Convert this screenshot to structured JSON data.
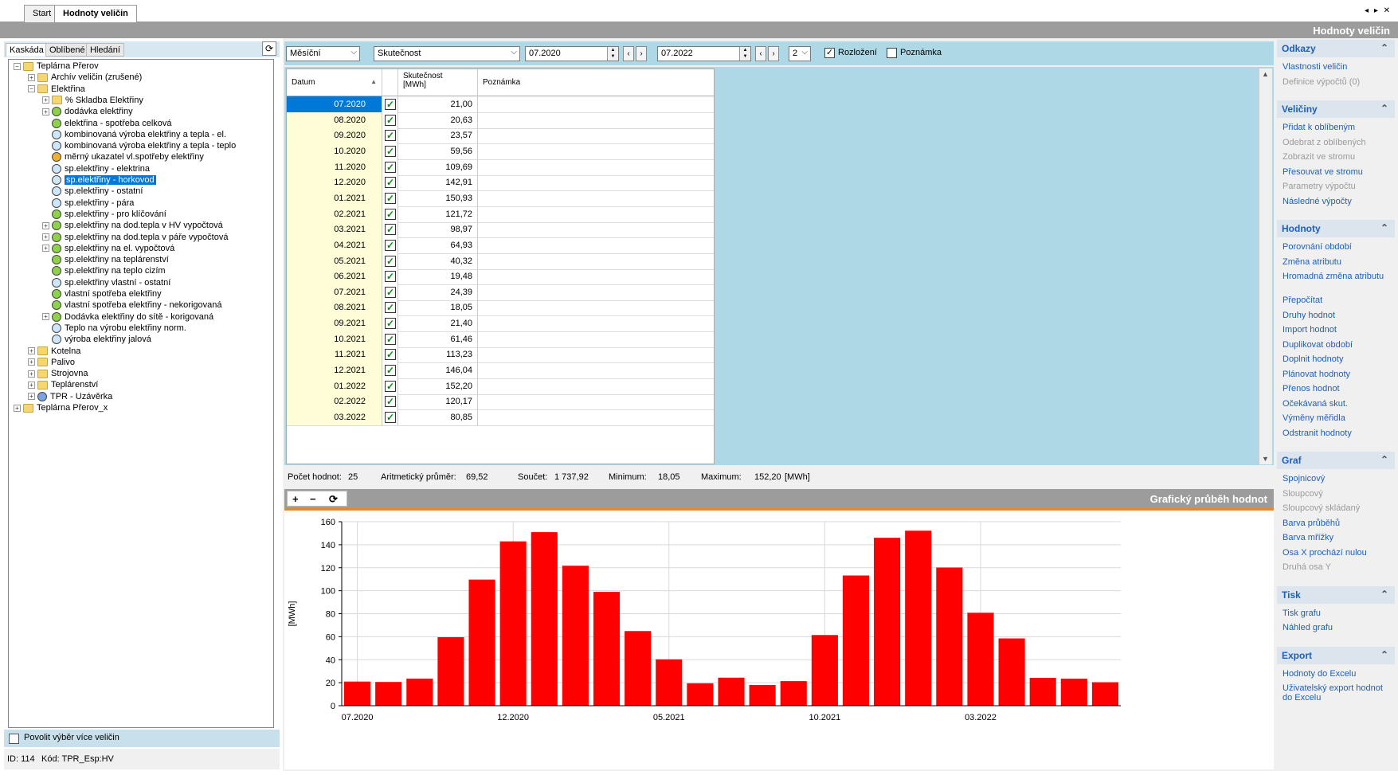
{
  "tabs": {
    "start": "Start",
    "active": "Hodnoty veličin"
  },
  "window_title": "Hodnoty veličin",
  "left": {
    "tabs": [
      "Kaskáda",
      "Oblíbené",
      "Hledání"
    ],
    "tree": [
      {
        "label": "Teplárna Přerov",
        "level": 0,
        "icon": "folder",
        "exp": "-"
      },
      {
        "label": "Archív veličin (zrušené)",
        "level": 1,
        "icon": "folder",
        "exp": "+"
      },
      {
        "label": "Elektřina",
        "level": 1,
        "icon": "folder",
        "exp": "-"
      },
      {
        "label": "% Skladba Elektřiny",
        "level": 2,
        "icon": "folder",
        "exp": "+"
      },
      {
        "label": "dodávka elektřiny",
        "level": 2,
        "icon": "green",
        "exp": "+"
      },
      {
        "label": "elektřina - spotřeba celková",
        "level": 2,
        "icon": "green",
        "exp": ""
      },
      {
        "label": "kombinovaná výroba elektřiny a tepla - el.",
        "level": 2,
        "icon": "blue",
        "exp": ""
      },
      {
        "label": "kombinovaná výroba elektřiny a tepla - teplo",
        "level": 2,
        "icon": "blue",
        "exp": ""
      },
      {
        "label": "měrný ukazatel vl.spotřeby elektřiny",
        "level": 2,
        "icon": "orange",
        "exp": ""
      },
      {
        "label": "sp.elektřiny - elektrina",
        "level": 2,
        "icon": "blue",
        "exp": ""
      },
      {
        "label": "sp.elektřiny - horkovod",
        "level": 2,
        "icon": "blue",
        "exp": "",
        "selected": true
      },
      {
        "label": "sp.elektřiny - ostatní",
        "level": 2,
        "icon": "blue",
        "exp": ""
      },
      {
        "label": "sp.elektřiny - pára",
        "level": 2,
        "icon": "blue",
        "exp": ""
      },
      {
        "label": "sp.elektřiny - pro klíčování",
        "level": 2,
        "icon": "green",
        "exp": ""
      },
      {
        "label": "sp.elektřiny na dod.tepla v HV vypočtová",
        "level": 2,
        "icon": "green",
        "exp": "+"
      },
      {
        "label": "sp.elektřiny na dod.tepla v páře vypočtová",
        "level": 2,
        "icon": "green",
        "exp": "+"
      },
      {
        "label": "sp.elektřiny na el. vypočtová",
        "level": 2,
        "icon": "green",
        "exp": "+"
      },
      {
        "label": "sp.elektřiny na teplárenství",
        "level": 2,
        "icon": "green",
        "exp": ""
      },
      {
        "label": "sp.elektřiny na teplo cizím",
        "level": 2,
        "icon": "green",
        "exp": ""
      },
      {
        "label": "sp.elektřiny vlastní - ostatní",
        "level": 2,
        "icon": "blue",
        "exp": ""
      },
      {
        "label": "vlastní spotřeba elektřiny",
        "level": 2,
        "icon": "green",
        "exp": ""
      },
      {
        "label": "vlastní spotřeba elektřiny - nekorigovaná",
        "level": 2,
        "icon": "green",
        "exp": ""
      },
      {
        "label": "Dodávka elektřiny do sítě - korigovaná",
        "level": 2,
        "icon": "green",
        "exp": "+"
      },
      {
        "label": "Teplo na výrobu elektřiny norm.",
        "level": 2,
        "icon": "blue",
        "exp": ""
      },
      {
        "label": "výroba elektřiny jalová",
        "level": 2,
        "icon": "blue",
        "exp": ""
      },
      {
        "label": "Kotelna",
        "level": 1,
        "icon": "folder",
        "exp": "+"
      },
      {
        "label": "Palivo",
        "level": 1,
        "icon": "folder",
        "exp": "+"
      },
      {
        "label": "Strojovna",
        "level": 1,
        "icon": "folder",
        "exp": "+"
      },
      {
        "label": "Teplárenství",
        "level": 1,
        "icon": "folder",
        "exp": "+"
      },
      {
        "label": "TPR - Uzávěrka",
        "level": 1,
        "icon": "navy",
        "exp": "+"
      },
      {
        "label": "Teplárna Přerov_x",
        "level": 0,
        "icon": "folder",
        "exp": "+"
      }
    ],
    "multi_label": "Povolit výběr více veličin",
    "id_text": "ID: 114",
    "code_text": "Kód: TPR_Esp:HV"
  },
  "toolbar": {
    "period": "Měsíční",
    "type": "Skutečnost",
    "from": "07.2020",
    "to": "07.2022",
    "count": "2",
    "rozlozeni_label": "Rozložení",
    "rozlozeni_checked": true,
    "poznamka_label": "Poznámka",
    "poznamka_checked": false
  },
  "grid": {
    "headers": {
      "datum": "Datum",
      "value": "Skutečnost",
      "unit": "[MWh]",
      "note": "Poznámka"
    },
    "rows": [
      {
        "d": "07.2020",
        "v": "21,00"
      },
      {
        "d": "08.2020",
        "v": "20,63"
      },
      {
        "d": "09.2020",
        "v": "23,57"
      },
      {
        "d": "10.2020",
        "v": "59,56"
      },
      {
        "d": "11.2020",
        "v": "109,69"
      },
      {
        "d": "12.2020",
        "v": "142,91"
      },
      {
        "d": "01.2021",
        "v": "150,93"
      },
      {
        "d": "02.2021",
        "v": "121,72"
      },
      {
        "d": "03.2021",
        "v": "98,97"
      },
      {
        "d": "04.2021",
        "v": "64,93"
      },
      {
        "d": "05.2021",
        "v": "40,32"
      },
      {
        "d": "06.2021",
        "v": "19,48"
      },
      {
        "d": "07.2021",
        "v": "24,39"
      },
      {
        "d": "08.2021",
        "v": "18,05"
      },
      {
        "d": "09.2021",
        "v": "21,40"
      },
      {
        "d": "10.2021",
        "v": "61,46"
      },
      {
        "d": "11.2021",
        "v": "113,23"
      },
      {
        "d": "12.2021",
        "v": "146,04"
      },
      {
        "d": "01.2022",
        "v": "152,20"
      },
      {
        "d": "02.2022",
        "v": "120,17"
      },
      {
        "d": "03.2022",
        "v": "80,85"
      }
    ]
  },
  "stats": {
    "count_label": "Počet hodnot:",
    "count": "25",
    "avg_label": "Aritmetický průměr:",
    "avg": "69,52",
    "sum_label": "Součet:",
    "sum": "1 737,92",
    "min_label": "Minimum:",
    "min": "18,05",
    "max_label": "Maximum:",
    "max": "152,20",
    "unit": "[MWh]"
  },
  "chart_head": "Grafický průběh hodnot",
  "chart_data": {
    "type": "bar",
    "categories": [
      "07.2020",
      "08.2020",
      "09.2020",
      "10.2020",
      "11.2020",
      "12.2020",
      "01.2021",
      "02.2021",
      "03.2021",
      "04.2021",
      "05.2021",
      "06.2021",
      "07.2021",
      "08.2021",
      "09.2021",
      "10.2021",
      "11.2021",
      "12.2021",
      "01.2022",
      "02.2022",
      "03.2022",
      "04.2022",
      "05.2022",
      "06.2022",
      "07.2022"
    ],
    "values": [
      21.0,
      20.63,
      23.57,
      59.56,
      109.69,
      142.91,
      150.93,
      121.72,
      98.97,
      64.93,
      40.32,
      19.48,
      24.39,
      18.05,
      21.4,
      61.46,
      113.23,
      146.04,
      152.2,
      120.17,
      80.85,
      58.5,
      24.2,
      23.5,
      20.4
    ],
    "xticks": [
      "07.2020",
      "12.2020",
      "05.2021",
      "10.2021",
      "03.2022"
    ],
    "yticks": [
      "0",
      "20",
      "40",
      "60",
      "80",
      "100",
      "120",
      "140",
      "160"
    ],
    "ylabel": "[MWh]",
    "ylim": [
      0,
      160
    ],
    "color": "#ff0000",
    "grid": true
  },
  "right": {
    "sections": [
      {
        "title": "Odkazy",
        "items": [
          {
            "t": "Vlastnosti veličin",
            "en": true
          },
          {
            "t": "Definice výpočtů (0)",
            "en": false
          }
        ]
      },
      {
        "title": "Veličiny",
        "items": [
          {
            "t": "Přidat k oblíbeným",
            "en": true
          },
          {
            "t": "Odebrat z oblíbených",
            "en": false
          },
          {
            "t": "Zobrazit ve stromu",
            "en": false
          },
          {
            "t": "Přesouvat ve stromu",
            "en": true
          },
          {
            "t": "Parametry výpočtu",
            "en": false
          },
          {
            "t": "Následné výpočty",
            "en": true
          }
        ]
      },
      {
        "title": "Hodnoty",
        "items": [
          {
            "t": "Porovnání období",
            "en": true
          },
          {
            "t": "Změna atributu",
            "en": true
          },
          {
            "t": "Hromadná změna atributu",
            "en": true
          },
          {
            "t": "Přepočítat",
            "en": true
          },
          {
            "t": "Druhy hodnot",
            "en": true
          },
          {
            "t": "Import hodnot",
            "en": true
          },
          {
            "t": "Duplikovat období",
            "en": true
          },
          {
            "t": "Doplnit hodnoty",
            "en": true
          },
          {
            "t": "Plánovat hodnoty",
            "en": true
          },
          {
            "t": "Přenos hodnot",
            "en": true
          },
          {
            "t": "Očekávaná skut.",
            "en": true
          },
          {
            "t": "Výměny měřidla",
            "en": true
          },
          {
            "t": "Odstranit hodnoty",
            "en": true
          }
        ]
      },
      {
        "title": "Graf",
        "items": [
          {
            "t": "Spojnicový",
            "en": true
          },
          {
            "t": "Sloupcový",
            "en": false
          },
          {
            "t": "Sloupcový skládaný",
            "en": false
          },
          {
            "t": "Barva průběhů",
            "en": true
          },
          {
            "t": "Barva mřížky",
            "en": true
          },
          {
            "t": "Osa X prochází nulou",
            "en": true
          },
          {
            "t": "Druhá osa Y",
            "en": false
          }
        ]
      },
      {
        "title": "Tisk",
        "items": [
          {
            "t": "Tisk grafu",
            "en": true
          },
          {
            "t": "Náhled grafu",
            "en": true
          }
        ]
      },
      {
        "title": "Export",
        "items": [
          {
            "t": "Hodnoty do Excelu",
            "en": true
          },
          {
            "t": "Uživatelský export hodnot do Excelu",
            "en": true
          }
        ]
      }
    ]
  }
}
